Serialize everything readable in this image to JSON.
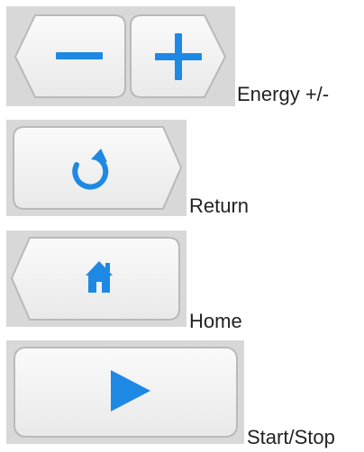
{
  "legend": {
    "energy": {
      "caption": "Energy +/-"
    },
    "return": {
      "caption": "Return"
    },
    "home": {
      "caption": "Home"
    },
    "start_stop": {
      "caption": "Start/Stop"
    }
  },
  "icons": {
    "energy_decrease": "minus-icon",
    "energy_increase": "plus-icon",
    "return": "refresh-icon",
    "home": "home-icon",
    "start_stop": "play-icon"
  },
  "colors": {
    "icon_blue": "#1e88e5",
    "tile_gray": "#d8d8d8",
    "button_face": "#f4f4f4",
    "button_edge": "#b9b9b9"
  }
}
